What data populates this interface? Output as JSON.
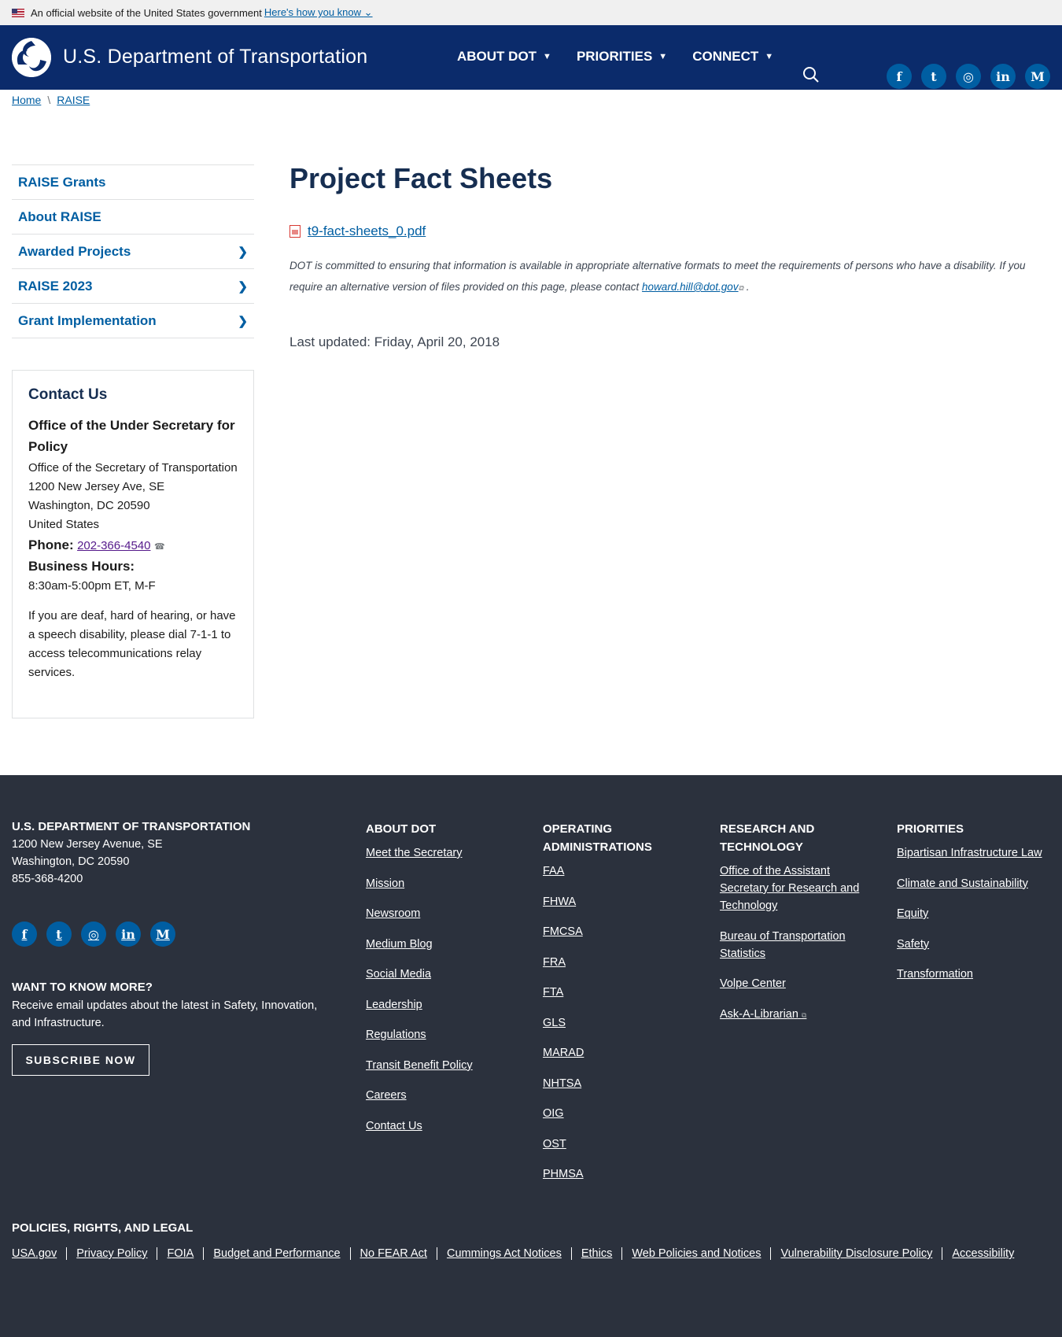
{
  "banner": {
    "text": "An official website of the United States government",
    "link": "Here's how you know"
  },
  "header": {
    "title": "U.S. Department of Transportation",
    "nav": [
      "ABOUT DOT",
      "PRIORITIES",
      "CONNECT"
    ]
  },
  "breadcrumb": [
    "Home",
    "RAISE"
  ],
  "sidenav": {
    "items": [
      {
        "label": "RAISE Grants"
      },
      {
        "label": "About RAISE"
      },
      {
        "label": "Awarded Projects"
      },
      {
        "label": "RAISE 2023"
      },
      {
        "label": "Grant Implementation"
      }
    ]
  },
  "contact": {
    "title": "Contact Us",
    "org": "Office of the Under Secretary for Policy",
    "addr1": "Office of the Secretary of Transportation",
    "addr2": "1200 New Jersey Ave, SE",
    "addr3": "Washington, DC 20590",
    "addr4": "United States",
    "phone_label": "Phone:",
    "phone": "202-366-4540",
    "hours_label": "Business Hours:",
    "hours": "8:30am-5:00pm ET, M-F",
    "deaf_note": "If you are deaf, hard of hearing, or have a speech disability, please dial 7-1-1 to access telecommunications relay services."
  },
  "main": {
    "title": "Project Fact Sheets",
    "file": "t9-fact-sheets_0.pdf",
    "notice": "DOT is committed to ensuring that information is available in appropriate alternative formats to meet the requirements of persons who have a disability. If you require an alternative version of files provided on this page, please contact",
    "notice_email": "howard.hill@dot.gov",
    "notice_end": ".",
    "updated": "Last updated: Friday, April 20, 2018"
  },
  "footer": {
    "org_title": "U.S. DEPARTMENT OF TRANSPORTATION",
    "org_addr1": "1200 New Jersey Avenue, SE",
    "org_addr2": "Washington, DC 20590",
    "org_phone": "855-368-4200",
    "more_title": "WANT TO KNOW MORE?",
    "more_text": "Receive email updates about the latest in Safety, Innovation, and Infrastructure.",
    "subscribe": "SUBSCRIBE NOW",
    "col1": {
      "title": "ABOUT DOT",
      "links": [
        "Meet the Secretary",
        "Mission",
        "Newsroom",
        "Medium Blog",
        "Social Media",
        "Leadership",
        "Regulations",
        "Transit Benefit Policy",
        "Careers",
        "Contact Us"
      ]
    },
    "col2": {
      "title": "OPERATING ADMINISTRATIONS",
      "links": [
        "FAA",
        "FHWA",
        "FMCSA",
        "FRA",
        "FTA",
        "GLS",
        "MARAD",
        "NHTSA",
        "OIG",
        "OST",
        "PHMSA"
      ]
    },
    "col3": {
      "title": "RESEARCH AND TECHNOLOGY",
      "links": [
        "Office of the Assistant Secretary for Research and Technology",
        "Bureau of Transportation Statistics",
        "Volpe Center",
        "Ask-A-Librarian"
      ]
    },
    "col4": {
      "title": "PRIORITIES",
      "links": [
        "Bipartisan Infrastructure Law",
        "Climate and Sustainability",
        "Equity",
        "Safety",
        "Transformation"
      ]
    },
    "legal_title": "POLICIES, RIGHTS, AND LEGAL",
    "legal": [
      "USA.gov",
      "Privacy Policy",
      "FOIA",
      "Budget and Performance",
      "No FEAR Act",
      "Cummings Act Notices",
      "Ethics",
      "Web Policies and Notices",
      "Vulnerability Disclosure Policy",
      "Accessibility"
    ]
  },
  "icons": {
    "social": [
      "facebook-icon",
      "twitter-icon",
      "instagram-icon",
      "linkedin-icon",
      "medium-icon"
    ]
  },
  "colors": {
    "header": "#0b2b6b",
    "footer": "#2b313d",
    "link": "#005ea2",
    "title": "#162e51"
  }
}
